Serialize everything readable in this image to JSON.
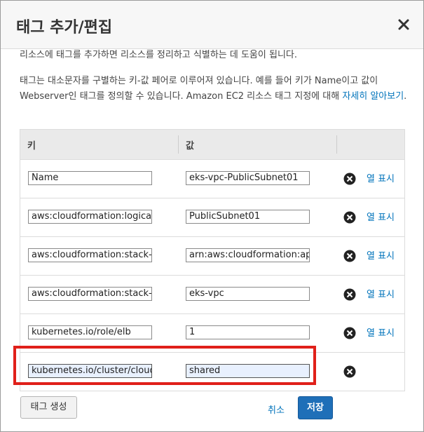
{
  "dialog": {
    "title": "태그 추가/편집",
    "description_1": "리소스에 태그를 추가하면 리소스를 정리하고 식별하는 데 도움이 됩니다.",
    "description_2": "태그는 대소문자를 구별하는 키-값 페어로 이루어져 있습니다. 예를 들어 키가 Name이고 값이 Webserver인 태그를 정의할 수 있습니다. Amazon EC2 리소스 태그 지정에 대해",
    "learn_more": "자세히 알아보기",
    "learn_more_suffix": "."
  },
  "table": {
    "col_key": "키",
    "col_value": "값",
    "rows": [
      {
        "key": "Name",
        "value": "eks-vpc-PublicSubnet01",
        "show": "열 표시"
      },
      {
        "key": "aws:cloudformation:logical-",
        "value": "PublicSubnet01",
        "show": "열 표시"
      },
      {
        "key": "aws:cloudformation:stack-ic",
        "value": "arn:aws:cloudformation:ap-",
        "show": "열 표시"
      },
      {
        "key": "aws:cloudformation:stack-n",
        "value": "eks-vpc",
        "show": "열 표시"
      },
      {
        "key": "kubernetes.io/role/elb",
        "value": "1",
        "show": "열 표시"
      },
      {
        "key": "kubernetes.io/cluster/cloud-",
        "value": "shared",
        "show": ""
      }
    ]
  },
  "footer": {
    "create_tag": "태그 생성",
    "cancel": "취소",
    "save": "저장"
  },
  "colors": {
    "accent": "#1f6fb8",
    "link": "#0073bb",
    "highlight_border": "#e0201a"
  }
}
